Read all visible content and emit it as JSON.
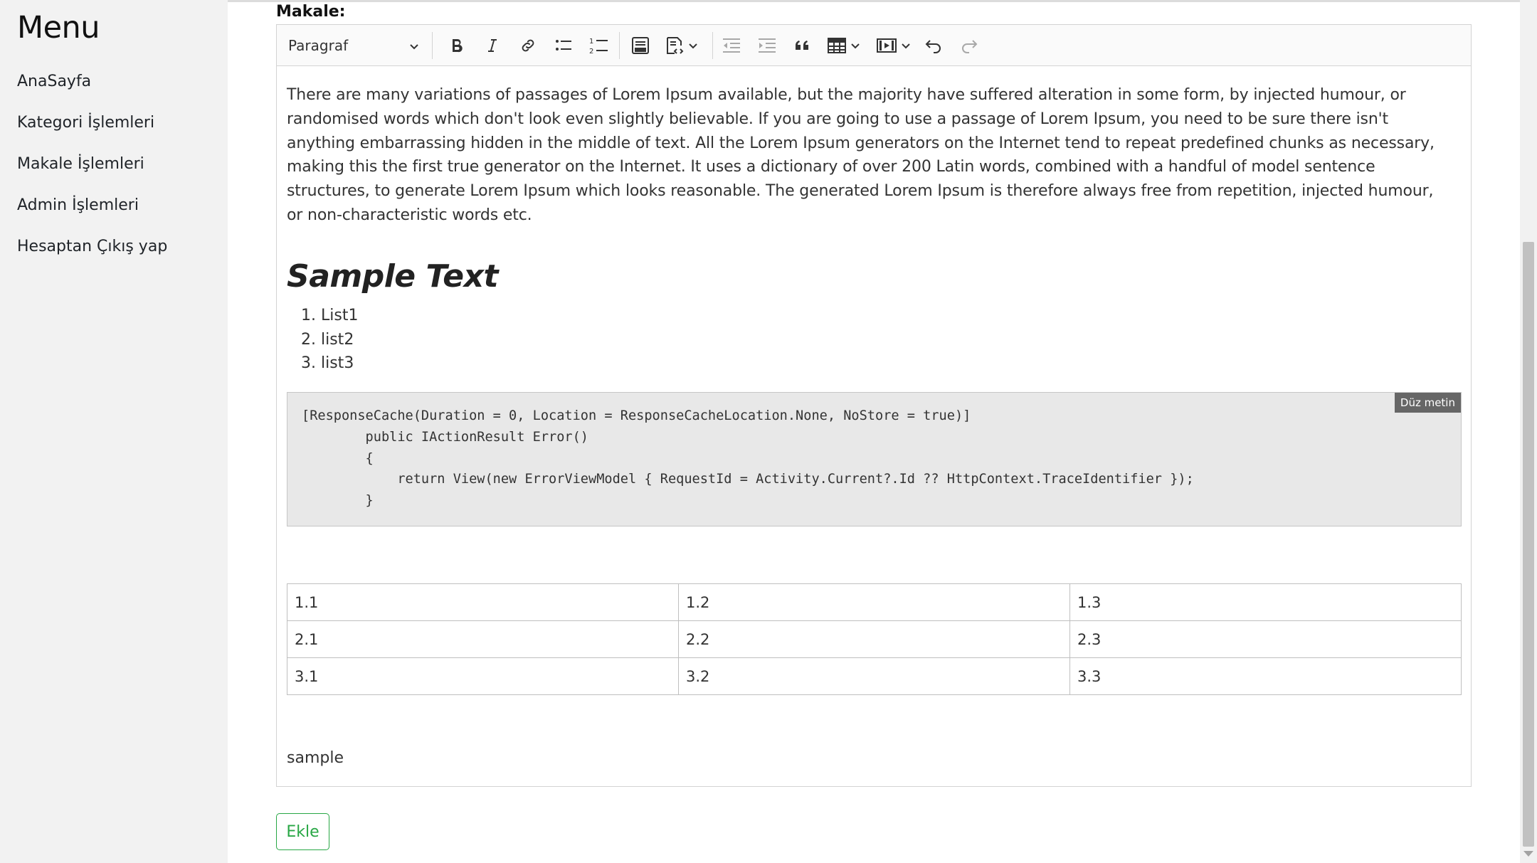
{
  "sidebar": {
    "title": "Menu",
    "items": [
      {
        "label": "AnaSayfa"
      },
      {
        "label": "Kategori İşlemleri"
      },
      {
        "label": "Makale İşlemleri"
      },
      {
        "label": "Admin İşlemleri"
      },
      {
        "label": "Hesaptan Çıkış yap"
      }
    ]
  },
  "form": {
    "label": "Makale:",
    "submit_label": "Ekle"
  },
  "toolbar": {
    "heading_dropdown": "Paragraf",
    "buttons": [
      "bold-icon",
      "italic-icon",
      "link-icon",
      "bulleted-list-icon",
      "numbered-list-icon",
      "html-embed-icon",
      "source-editing-icon",
      "outdent-icon",
      "indent-icon",
      "blockquote-icon",
      "table-icon",
      "media-embed-icon",
      "undo-icon",
      "redo-icon"
    ]
  },
  "content": {
    "paragraph": "There are many variations of passages of Lorem Ipsum available, but the majority have suffered alteration in some form, by injected humour, or randomised words which don't look even slightly believable. If you are going to use a passage of Lorem Ipsum, you need to be sure there isn't anything embarrassing hidden in the middle of text. All the Lorem Ipsum generators on the Internet tend to repeat predefined chunks as necessary, making this the first true generator on the Internet. It uses a dictionary of over 200 Latin words, combined with a handful of model sentence structures, to generate Lorem Ipsum which looks reasonable. The generated Lorem Ipsum is therefore always free from repetition, injected humour, or non-characteristic words etc.",
    "heading": "Sample Text",
    "list": [
      "List1",
      "list2",
      "list3"
    ],
    "code": {
      "language_badge": "Düz metin",
      "text": "[ResponseCache(Duration = 0, Location = ResponseCacheLocation.None, NoStore = true)]\n        public IActionResult Error()\n        {\n            return View(new ErrorViewModel { RequestId = Activity.Current?.Id ?? HttpContext.TraceIdentifier });\n        }"
    },
    "table": [
      [
        "1.1",
        "1.2",
        "1.3"
      ],
      [
        "2.1",
        "2.2",
        "2.3"
      ],
      [
        "3.1",
        "3.2",
        "3.3"
      ]
    ],
    "closing_text": "sample"
  },
  "colors": {
    "sidebar_bg": "#f2f2f2",
    "accent_green": "#28a745",
    "code_bg": "#e8e8e8"
  }
}
